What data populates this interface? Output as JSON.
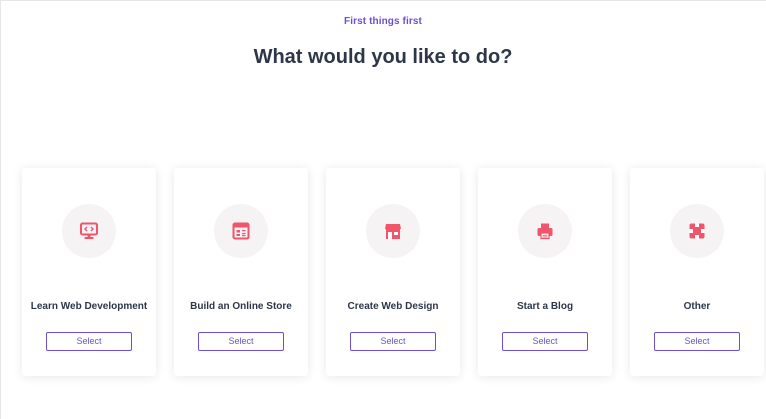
{
  "header": {
    "eyebrow": "First things first",
    "title": "What would you like to do?"
  },
  "colors": {
    "accent": "#6d4fd1",
    "icon": "#f0556b",
    "heading": "#2d3748",
    "icon_background": "#f5f3f3"
  },
  "options": [
    {
      "label": "Learn Web Development",
      "icon": "monitor-code-icon",
      "button": "Select"
    },
    {
      "label": "Build an Online Store",
      "icon": "store-window-icon",
      "button": "Select"
    },
    {
      "label": "Create Web Design",
      "icon": "shop-awning-icon",
      "button": "Select"
    },
    {
      "label": "Start a Blog",
      "icon": "printer-icon",
      "button": "Select"
    },
    {
      "label": "Other",
      "icon": "puzzle-icon",
      "button": "Select"
    }
  ]
}
